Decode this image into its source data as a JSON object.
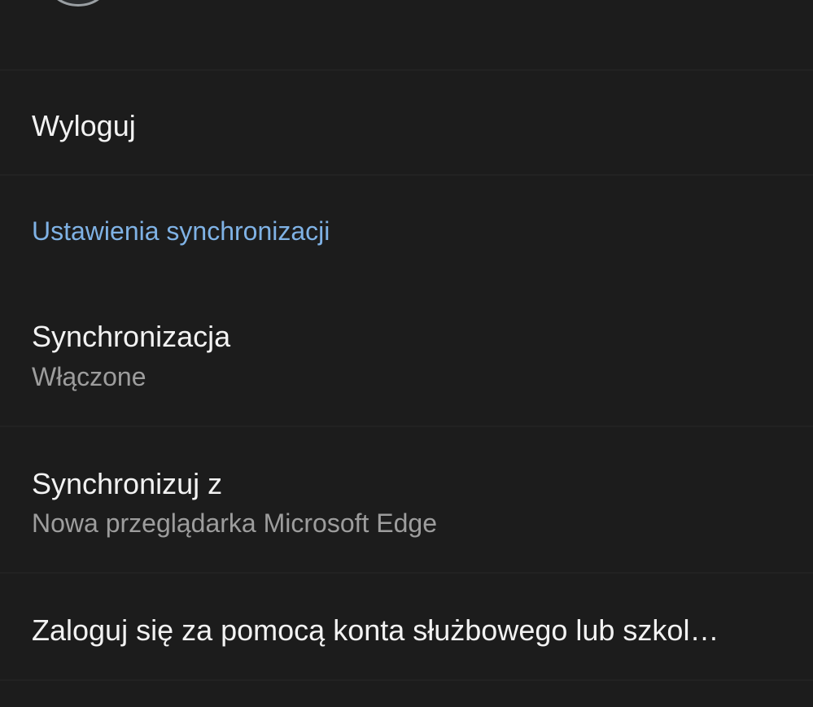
{
  "account": {
    "name_partial": "",
    "avatar_icon": "avatar-icon"
  },
  "items": {
    "signout": {
      "label": "Wyloguj"
    },
    "sync_section": {
      "label": "Ustawienia synchronizacji"
    },
    "sync": {
      "label": "Synchronizacja",
      "value": "Włączone"
    },
    "sync_with": {
      "label": "Synchronizuj z",
      "value": "Nowa przeglądarka Microsoft Edge"
    },
    "work_login": {
      "label": "Zaloguj się za pomocą konta służbowego lub szkol…"
    }
  },
  "colors": {
    "background": "#1c1c1c",
    "accent": "#7fb2e5",
    "primary_text": "#f2f2f2",
    "secondary_text": "#9d9d9d"
  }
}
